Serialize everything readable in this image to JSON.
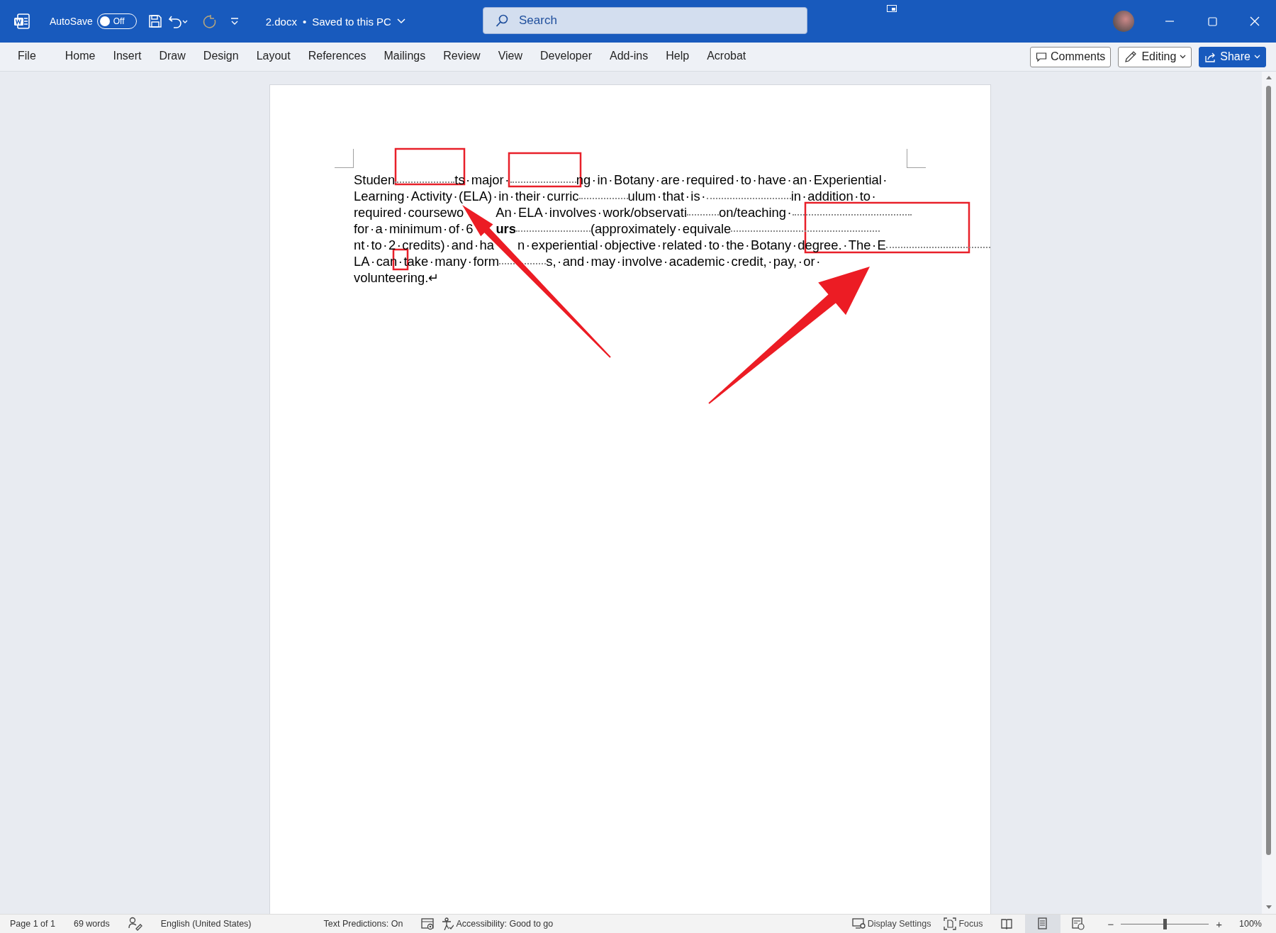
{
  "titlebar": {
    "autosave": {
      "label": "AutoSave",
      "state": "Off",
      "on": false
    },
    "redo_disabled": true,
    "file_name": "2.docx",
    "separator": "•",
    "save_status": "Saved to this PC",
    "search": {
      "placeholder": "Search"
    }
  },
  "ribbon": {
    "tabs": [
      {
        "label": "File",
        "selected": false
      },
      {
        "label": "Home",
        "selected": false
      },
      {
        "label": "Insert",
        "selected": false
      },
      {
        "label": "Draw",
        "selected": false
      },
      {
        "label": "Design",
        "selected": false
      },
      {
        "label": "Layout",
        "selected": false
      },
      {
        "label": "References",
        "selected": false
      },
      {
        "label": "Mailings",
        "selected": false
      },
      {
        "label": "Review",
        "selected": false
      },
      {
        "label": "View",
        "selected": false
      },
      {
        "label": "Developer",
        "selected": false
      },
      {
        "label": "Add-ins",
        "selected": false
      },
      {
        "label": "Help",
        "selected": false
      },
      {
        "label": "Acrobat",
        "selected": false
      }
    ],
    "buttons": [
      {
        "kind": "comments",
        "label": "Comments"
      },
      {
        "kind": "editing",
        "label": "Editing"
      },
      {
        "kind": "share",
        "label": "Share"
      }
    ]
  },
  "document": {
    "lines": [
      [
        {
          "kind": "text",
          "text": "Studen"
        },
        {
          "kind": "tab"
        },
        {
          "kind": "text",
          "text": "ts·major·"
        },
        {
          "kind": "tab"
        },
        {
          "kind": "text",
          "text": "ng·in·Botany·are·required·to·have·an·Experiential·"
        }
      ],
      [
        {
          "kind": "text",
          "text": "Learning·Activity·(ELA)·in·their·curric"
        },
        {
          "kind": "tab"
        },
        {
          "kind": "text",
          "text": "ulum·that·is·"
        },
        {
          "kind": "tab"
        },
        {
          "kind": "text",
          "text": "in·addition·to·"
        }
      ],
      [
        {
          "kind": "text",
          "text": "required·coursewo"
        },
        {
          "kind": "covered"
        },
        {
          "kind": "text",
          "text": "An·ELA·involves·work/observati"
        },
        {
          "kind": "tab"
        },
        {
          "kind": "text",
          "text": "on/teaching·"
        },
        {
          "kind": "tab"
        }
      ],
      [
        {
          "kind": "text",
          "text": "for·a·minimum·of·6"
        },
        {
          "kind": "covered"
        },
        {
          "kind": "text",
          "text": "urs",
          "bold": true
        },
        {
          "kind": "tab"
        },
        {
          "kind": "text",
          "text": "(approximately·equivale"
        },
        {
          "kind": "tab"
        }
      ],
      [
        {
          "kind": "text",
          "text": "nt·to·2·credits)·and·ha"
        },
        {
          "kind": "covered"
        },
        {
          "kind": "text",
          "text": "n·experiential·objective·related·to·the·Botany·degree.·The·E"
        },
        {
          "kind": "tab"
        }
      ],
      [
        {
          "kind": "text",
          "text": "LA·can·take·many·form"
        },
        {
          "kind": "tab"
        },
        {
          "kind": "text",
          "text": "s,·and·may·involve·academic·credit,·pay,·or·"
        }
      ],
      [
        {
          "kind": "text",
          "text": "volunteering.↵"
        }
      ]
    ],
    "annotations": [
      {
        "kind": "box"
      },
      {
        "kind": "box"
      },
      {
        "kind": "box"
      },
      {
        "kind": "box"
      },
      {
        "kind": "arrow"
      },
      {
        "kind": "arrow"
      }
    ]
  },
  "statusbar": {
    "left": [
      {
        "kind": "text",
        "text": "Page 1 of 1"
      },
      {
        "kind": "text",
        "text": "69 words"
      },
      {
        "kind": "proofing"
      },
      {
        "kind": "text",
        "text": "English (United States)"
      },
      {
        "kind": "text",
        "text": "Text Predictions: On"
      },
      {
        "kind": "macro"
      },
      {
        "kind": "accessibility",
        "text": "Accessibility: Good to go"
      }
    ],
    "display_settings": "Display Settings",
    "focus": "Focus",
    "views": [
      {
        "kind": "read",
        "selected": false
      },
      {
        "kind": "print",
        "selected": true
      },
      {
        "kind": "web",
        "selected": false
      }
    ],
    "zoom": {
      "minus": "−",
      "plus": "+",
      "level": 0.5,
      "reading": "100%"
    }
  }
}
